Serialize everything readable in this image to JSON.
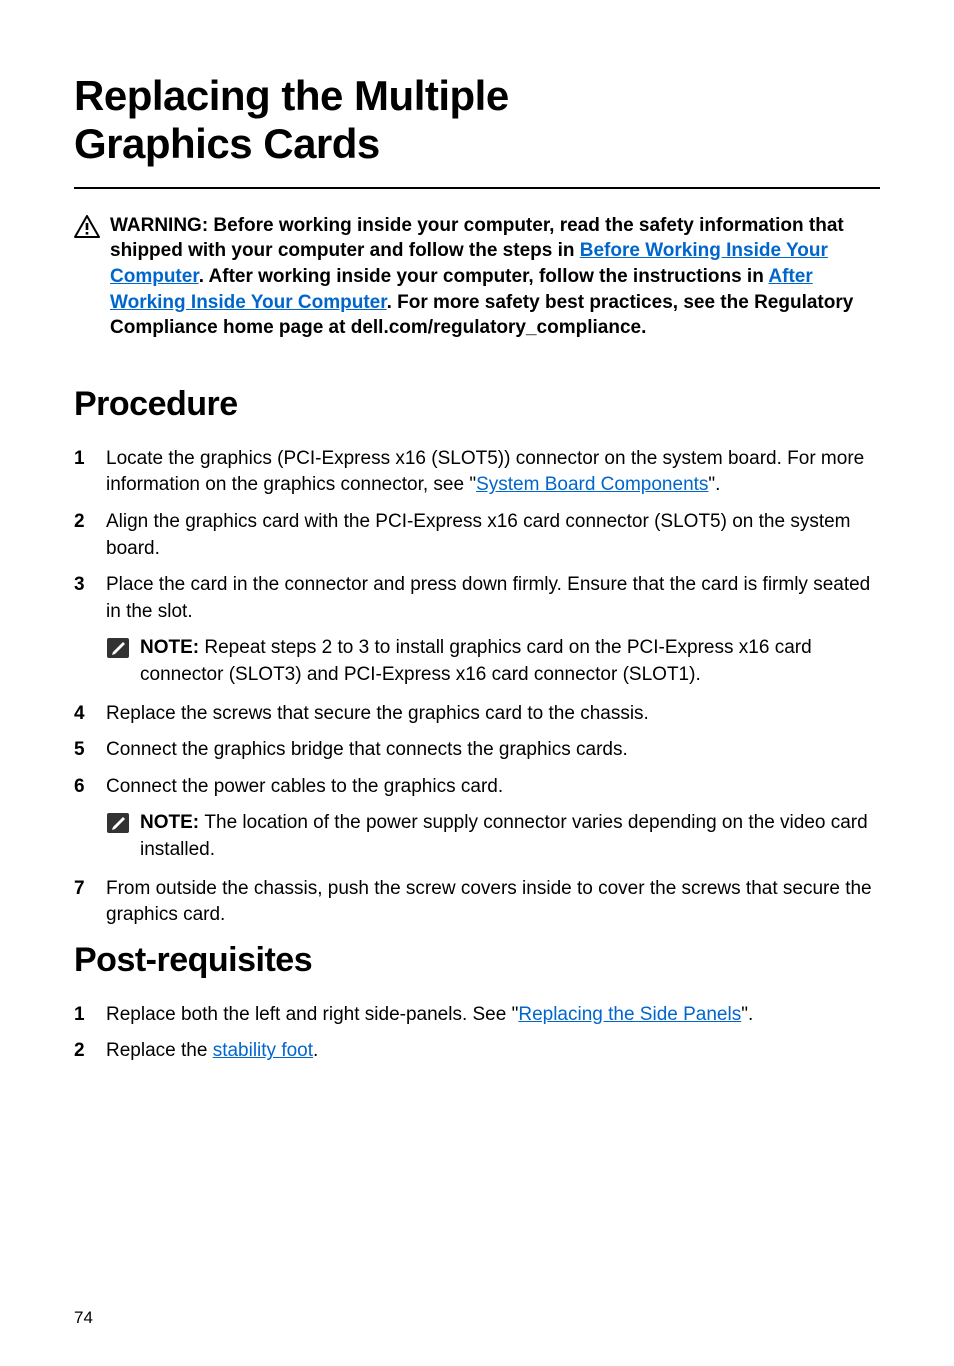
{
  "title_line1": "Replacing the Multiple",
  "title_line2": "Graphics Cards",
  "warning": {
    "prefix": "WARNING: Before working inside your computer, read the safety information that shipped with your computer and follow the steps in ",
    "link1": "Before Working Inside Your Computer",
    "mid1": ". After working inside your computer, follow the instructions in ",
    "link2": "After Working Inside Your Computer",
    "suffix": ". For more safety best practices, see the Regulatory Compliance home page at dell.com/regulatory_compliance."
  },
  "procedure_heading": "Procedure",
  "steps": {
    "s1a": "Locate the graphics (PCI-Express x16 (SLOT5)) connector on the system board. For more information on the graphics connector, see \"",
    "s1_link": "System Board Components",
    "s1b": "\".",
    "s2": "Align the graphics card with the PCI-Express x16 card connector (SLOT5) on the system board.",
    "s3": "Place the card in the connector and press down firmly. Ensure that the card is firmly seated in the slot.",
    "note1_label": "NOTE: ",
    "note1_body": "Repeat steps 2 to 3 to install graphics card on the PCI-Express x16 card connector (SLOT3) and PCI-Express x16 card connector (SLOT1).",
    "s4": "Replace the screws that secure the graphics card to the chassis.",
    "s5": "Connect the graphics bridge that connects the graphics cards.",
    "s6": "Connect the power cables to the graphics card.",
    "note2_label": "NOTE: ",
    "note2_body": "The location of the power supply connector varies depending on the video card installed.",
    "s7": "From outside the chassis, push the screw covers inside to cover the screws that secure the graphics card."
  },
  "post_heading": "Post-requisites",
  "post": {
    "p1a": "Replace both the left and right side-panels. See \"",
    "p1_link": "Replacing the Side Panels",
    "p1b": "\".",
    "p2a": "Replace the ",
    "p2_link": "stability foot",
    "p2b": "."
  },
  "page_number": "74"
}
